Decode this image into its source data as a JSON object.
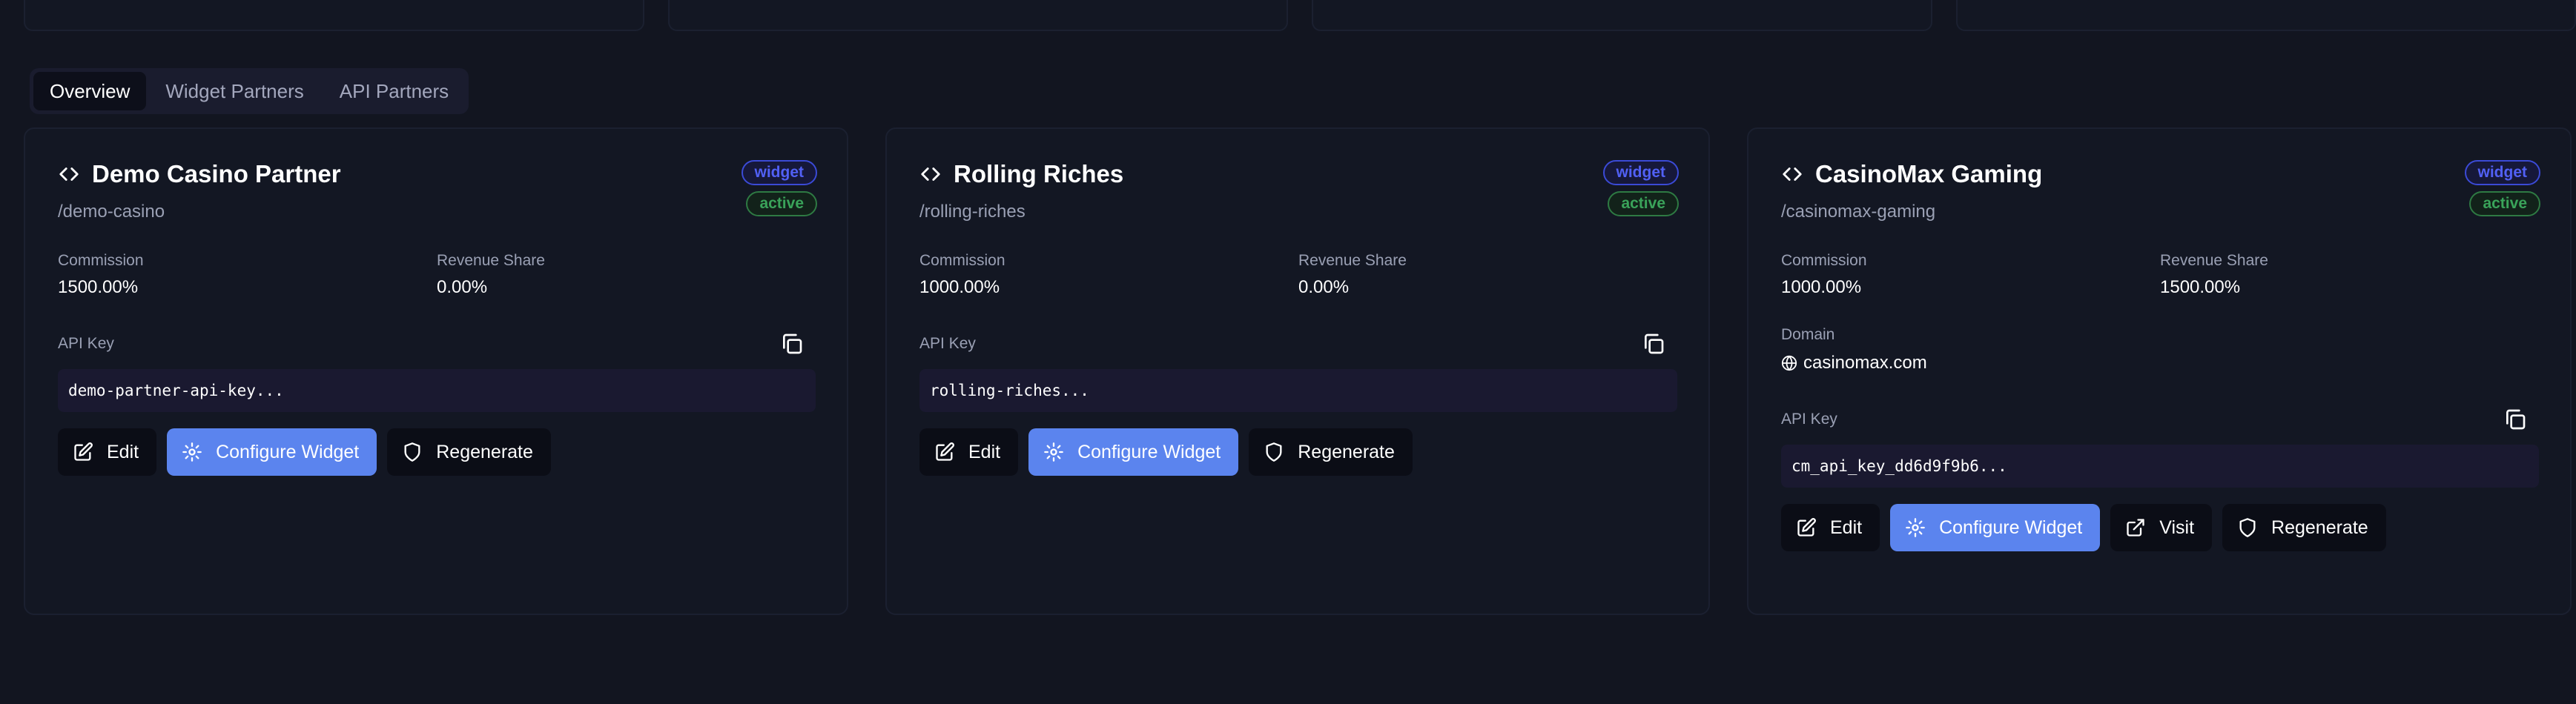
{
  "tabs": [
    {
      "label": "Overview",
      "active": true
    },
    {
      "label": "Widget Partners",
      "active": false
    },
    {
      "label": "API Partners",
      "active": false
    }
  ],
  "labels": {
    "commission": "Commission",
    "revenue_share": "Revenue Share",
    "api_key": "API Key",
    "domain": "Domain"
  },
  "buttons": {
    "edit": "Edit",
    "configure": "Configure Widget",
    "visit": "Visit",
    "regenerate": "Regenerate"
  },
  "partners": [
    {
      "name": "Demo Casino Partner",
      "slug": "/demo-casino",
      "type_badge": "widget",
      "status_badge": "active",
      "commission": "1500.00%",
      "revenue_share": "0.00%",
      "api_key": "demo-partner-api-key..."
    },
    {
      "name": "Rolling Riches",
      "slug": "/rolling-riches",
      "type_badge": "widget",
      "status_badge": "active",
      "commission": "1000.00%",
      "revenue_share": "0.00%",
      "api_key": "rolling-riches..."
    },
    {
      "name": "CasinoMax Gaming",
      "slug": "/casinomax-gaming",
      "type_badge": "widget",
      "status_badge": "active",
      "commission": "1000.00%",
      "revenue_share": "1500.00%",
      "domain": "casinomax.com",
      "api_key": "cm_api_key_dd6d9f9b6..."
    }
  ],
  "icons": {
    "title": "code-icon",
    "copy": "copy-icon",
    "edit": "edit-icon",
    "configure": "gear-icon",
    "visit": "external-link-icon",
    "regenerate": "shield-icon",
    "domain": "globe-icon"
  },
  "colors": {
    "background": "#121520",
    "primary": "#5b84ee",
    "badge_widget": "#5160f5",
    "badge_active": "#3aa35a"
  }
}
